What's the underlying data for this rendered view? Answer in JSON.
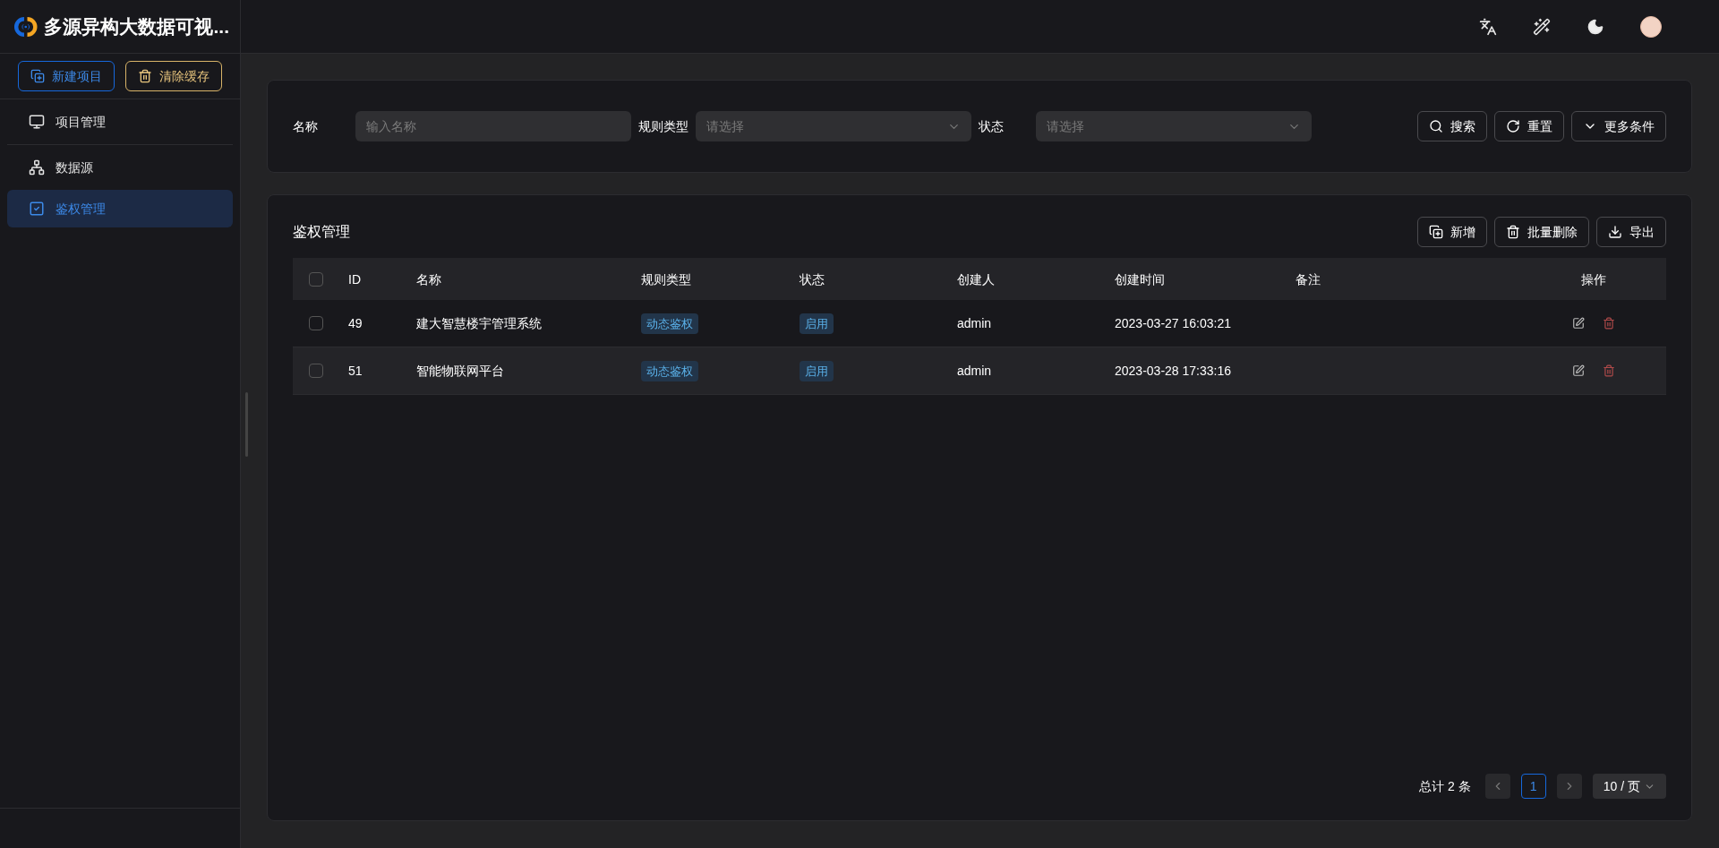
{
  "app": {
    "title": "多源异构大数据可视..."
  },
  "sidebar": {
    "buttons": [
      {
        "label": "新建项目",
        "kind": "primary"
      },
      {
        "label": "清除缓存",
        "kind": "warning"
      }
    ],
    "items": [
      {
        "label": "项目管理",
        "kind": "monitor",
        "selected": false
      },
      {
        "label": "数据源",
        "kind": "datasource",
        "selected": false
      },
      {
        "label": "鉴权管理",
        "kind": "auth",
        "selected": true
      }
    ]
  },
  "filters": {
    "fields": [
      {
        "label": "名称",
        "kind": "input",
        "placeholder": "输入名称"
      },
      {
        "label": "规则类型",
        "kind": "select",
        "placeholder": "请选择"
      },
      {
        "label": "状态",
        "kind": "select",
        "placeholder": "请选择"
      }
    ],
    "buttons": [
      {
        "label": "搜索",
        "kind": "search"
      },
      {
        "label": "重置",
        "kind": "reset"
      },
      {
        "label": "更多条件",
        "kind": "more"
      }
    ]
  },
  "table": {
    "title": "鉴权管理",
    "buttons": [
      {
        "label": "新增",
        "kind": "add"
      },
      {
        "label": "批量删除",
        "kind": "delete"
      },
      {
        "label": "导出",
        "kind": "export"
      }
    ],
    "select_all": {
      "checked": false
    },
    "columns": [
      "ID",
      "名称",
      "规则类型",
      "状态",
      "创建人",
      "创建时间",
      "备注",
      "操作"
    ],
    "rows": [
      {
        "checked": false,
        "hovered": false,
        "id": "49",
        "name": "建大智慧楼宇管理系统",
        "rule_type": "动态鉴权",
        "status": "启用",
        "creator": "admin",
        "created": "2023-03-27 16:03:21"
      },
      {
        "checked": false,
        "hovered": true,
        "id": "51",
        "name": "智能物联网平台",
        "rule_type": "动态鉴权",
        "status": "启用",
        "creator": "admin",
        "created": "2023-03-28 17:33:16"
      }
    ]
  },
  "pagination": {
    "total": "总计 2 条",
    "pages": [
      {
        "label": "1",
        "selected": true
      }
    ],
    "page_size": "10 / 页"
  }
}
